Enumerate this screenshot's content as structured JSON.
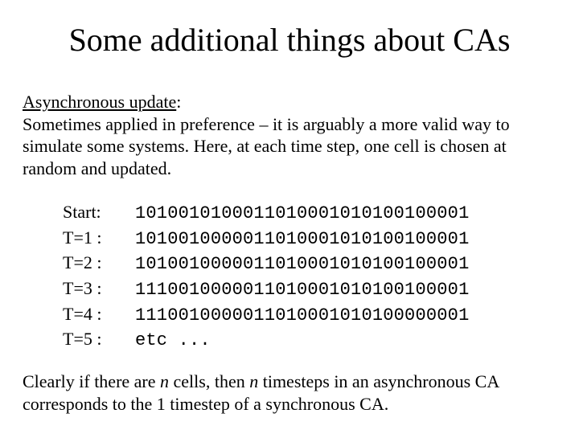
{
  "title": "Some additional things about CAs",
  "intro": {
    "label": "Asynchronous update",
    "colon": ":",
    "rest": "Sometimes applied in preference – it is arguably a more valid way to simulate some systems. Here, at each time step, one cell is chosen at random and updated."
  },
  "steps": [
    {
      "label": "Start:",
      "value": "1010010100011010001010100100001"
    },
    {
      "label": "T=1 :",
      "value": "1010010000011010001010100100001"
    },
    {
      "label": "T=2 :",
      "value": "1010010000011010001010100100001"
    },
    {
      "label": "T=3 :",
      "value": "1110010000011010001010100100001"
    },
    {
      "label": "T=4 :",
      "value": "1110010000011010001010100000001"
    },
    {
      "label": "T=5 :",
      "value": "etc ..."
    }
  ],
  "closing": {
    "p1": "Clearly if there are ",
    "n1": "n",
    "p2": " cells, then ",
    "n2": "n",
    "p3": " timesteps in an asynchronous CA corresponds to the 1 timestep of a synchronous CA."
  }
}
